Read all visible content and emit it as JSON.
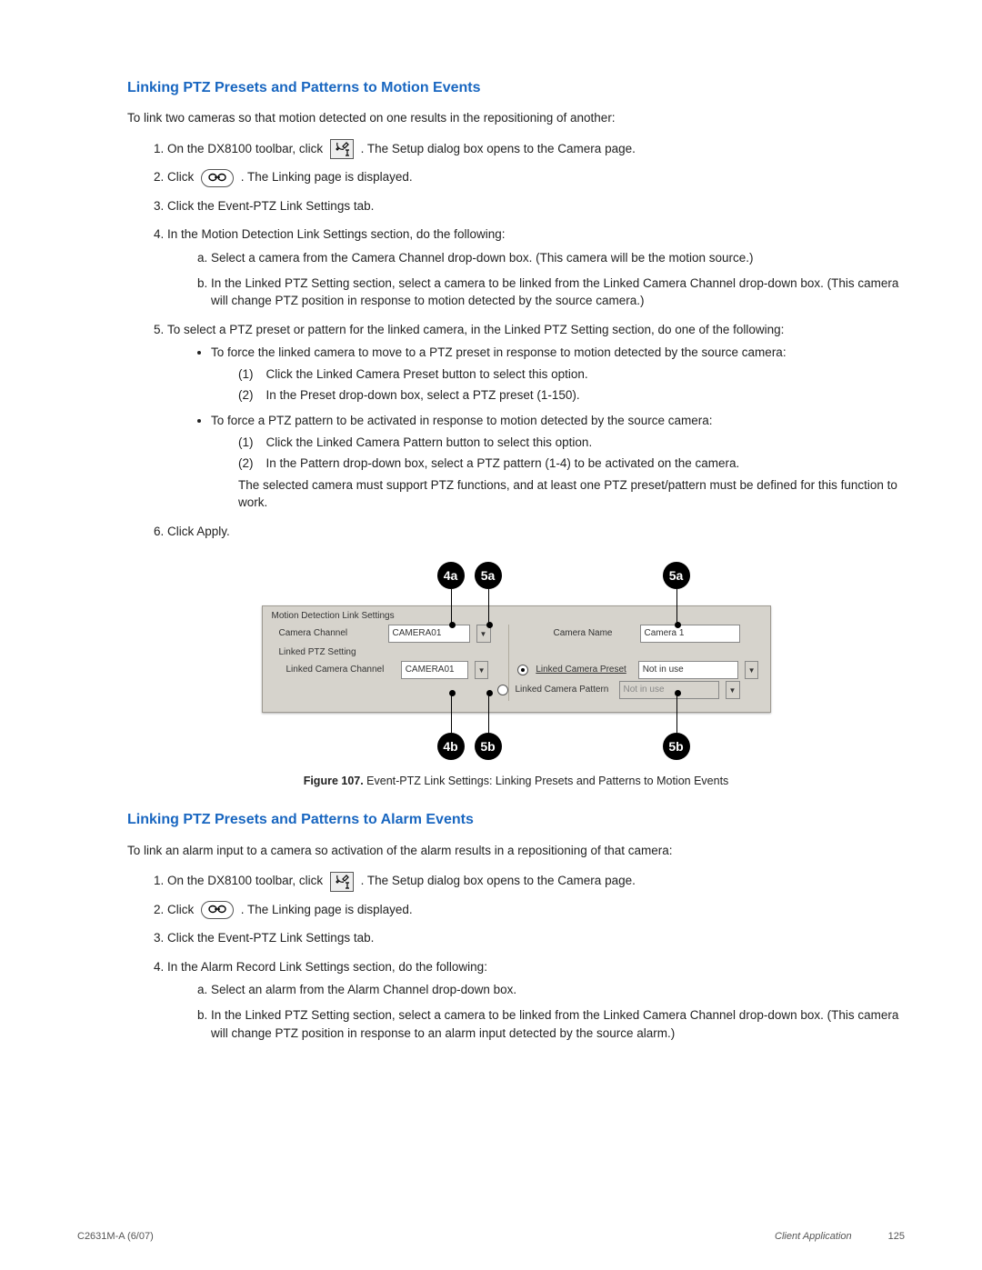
{
  "section1": {
    "heading": "Linking PTZ Presets and Patterns to Motion Events",
    "intro": "To link two cameras so that motion detected on one results in the repositioning of another:",
    "steps": {
      "s1a": "On the DX8100 toolbar, click",
      "s1b": ". The Setup dialog box opens to the Camera page.",
      "s2a": "Click",
      "s2b": ". The Linking page is displayed.",
      "s3": "Click the Event-PTZ Link Settings tab.",
      "s4lead": "In the Motion Detection Link Settings section, do the following:",
      "s4a": "Select a camera from the Camera Channel drop-down box. (This camera will be the motion source.)",
      "s4b": "In the Linked PTZ Setting section, select a camera to be linked from the Linked Camera Channel drop-down box. (This camera will change PTZ position in response to motion detected by the source camera.)",
      "s5lead": "To select a PTZ preset or pattern for the linked camera, in the Linked PTZ Setting section, do one of the following:",
      "b1lead": "To force the linked camera to move to a PTZ preset in response to motion detected by the source camera:",
      "b1_1": "Click the Linked Camera Preset button to select this option.",
      "b1_2": "In the Preset drop-down box, select a PTZ preset (1-150).",
      "b2lead": "To force a PTZ pattern to be activated in response to motion detected by the source camera:",
      "b2_1": "Click the Linked Camera Pattern button to select this option.",
      "b2_2": "In the Pattern drop-down box, select a PTZ pattern (1-4) to be activated on the camera.",
      "b2_note": "The selected camera must support PTZ functions, and at least one PTZ preset/pattern must be defined for this function to work.",
      "s6": "Click Apply."
    }
  },
  "figure": {
    "callouts": {
      "a1": "4a",
      "a2": "5a",
      "a3": "5a",
      "b1": "4b",
      "b2": "5b",
      "b3": "5b"
    },
    "panel": {
      "group_label": "Motion Detection Link Settings",
      "sub_label": "Linked PTZ Setting",
      "camera_channel_label": "Camera Channel",
      "camera_channel_value": "CAMERA01",
      "camera_name_label": "Camera Name",
      "camera_name_value": "Camera 1",
      "linked_channel_label": "Linked Camera Channel",
      "linked_channel_value": "CAMERA01",
      "radio_preset_label": "Linked Camera Preset",
      "radio_pattern_label": "Linked Camera Pattern",
      "preset_value": "Not in use",
      "pattern_value": "Not in use"
    },
    "caption_prefix": "Figure 107.",
    "caption_text": " Event-PTZ Link Settings: Linking Presets and Patterns to Motion Events"
  },
  "section2": {
    "heading": "Linking PTZ Presets and Patterns to Alarm Events",
    "intro": "To link an alarm input to a camera so activation of the alarm results in a repositioning of that camera:",
    "steps": {
      "s1a": "On the DX8100 toolbar, click",
      "s1b": ". The Setup dialog box opens to the Camera page.",
      "s2a": "Click",
      "s2b": ". The Linking page is displayed.",
      "s3": "Click the Event-PTZ Link Settings tab.",
      "s4lead": "In the Alarm Record Link Settings section, do the following:",
      "s4a": "Select an alarm from the Alarm Channel drop-down box.",
      "s4b": "In the Linked PTZ Setting section, select a camera to be linked from the Linked Camera Channel drop-down box. (This camera will change PTZ position in response to an alarm input detected by the source alarm.)"
    }
  },
  "footer": {
    "left": "C2631M-A (6/07)",
    "app": "Client Application",
    "page": "125"
  }
}
